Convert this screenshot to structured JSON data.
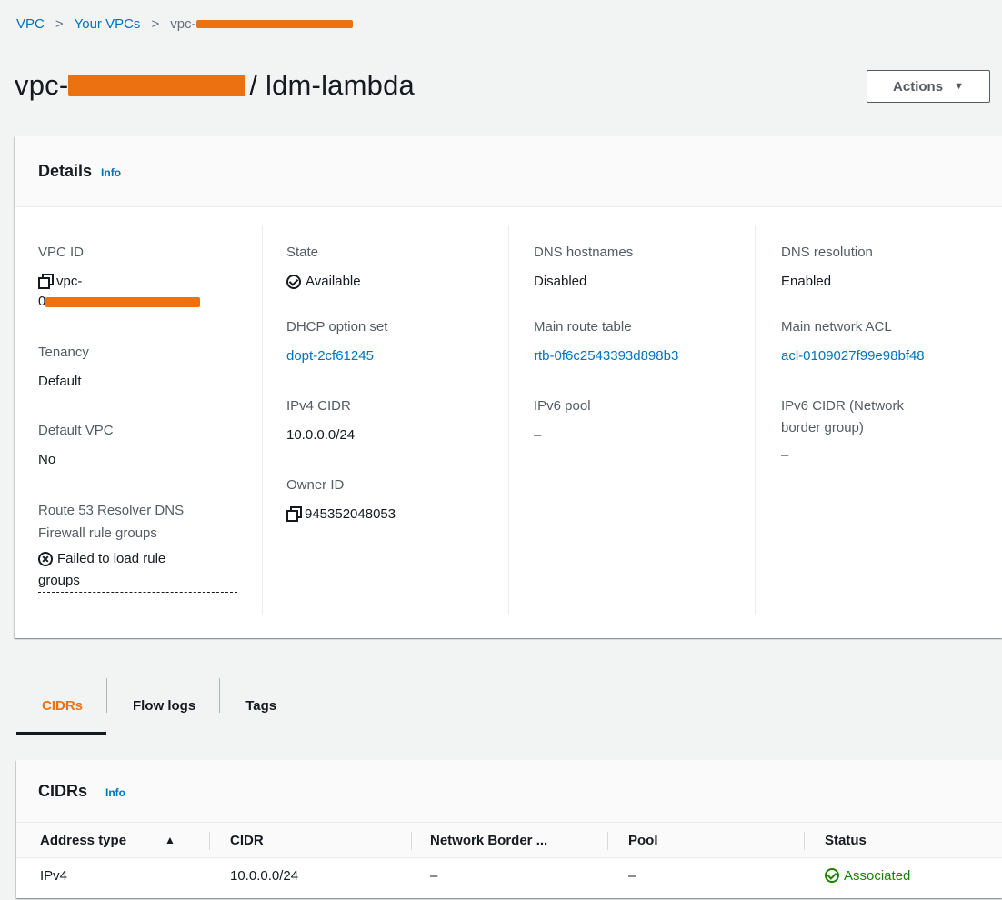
{
  "breadcrumb": {
    "items": [
      "VPC",
      "Your VPCs"
    ],
    "current_prefix": "vpc-",
    "separator": ">"
  },
  "header": {
    "title_prefix": "vpc-",
    "title_suffix": "/ ldm-lambda",
    "actions_label": "Actions"
  },
  "details": {
    "title": "Details",
    "info_label": "Info",
    "col1": {
      "vpc_id_label": "VPC ID",
      "vpc_id_prefix": "vpc-",
      "vpc_id_line2_prefix": "0",
      "tenancy_label": "Tenancy",
      "tenancy_value": "Default",
      "default_vpc_label": "Default VPC",
      "default_vpc_value": "No",
      "route53_label_line1": "Route 53 Resolver DNS",
      "route53_label_line2": "Firewall rule groups",
      "route53_error_line1": "Failed to load rule",
      "route53_error_line2": "groups"
    },
    "col2": {
      "state_label": "State",
      "state_value": "Available",
      "dhcp_label": "DHCP option set",
      "dhcp_value": "dopt-2cf61245",
      "ipv4_label": "IPv4 CIDR",
      "ipv4_value": "10.0.0.0/24",
      "owner_label": "Owner ID",
      "owner_value": "945352048053"
    },
    "col3": {
      "dns_hostnames_label": "DNS hostnames",
      "dns_hostnames_value": "Disabled",
      "route_table_label": "Main route table",
      "route_table_value": "rtb-0f6c2543393d898b3",
      "ipv6_pool_label": "IPv6 pool",
      "ipv6_pool_value": "–"
    },
    "col4": {
      "dns_resolution_label": "DNS resolution",
      "dns_resolution_value": "Enabled",
      "acl_label": "Main network ACL",
      "acl_value": "acl-0109027f99e98bf48",
      "ipv6_cidr_label_line1": "IPv6 CIDR (Network",
      "ipv6_cidr_label_line2": "border group)",
      "ipv6_cidr_value": "–"
    }
  },
  "tabs": [
    {
      "label": "CIDRs",
      "active": true
    },
    {
      "label": "Flow logs",
      "active": false
    },
    {
      "label": "Tags",
      "active": false
    }
  ],
  "cidrs_table": {
    "title": "CIDRs",
    "info_label": "Info",
    "columns": [
      "Address type",
      "CIDR",
      "Network Border ...",
      "Pool",
      "Status"
    ],
    "sort_indicator": "▲",
    "rows": [
      {
        "address_type": "IPv4",
        "cidr": "10.0.0.0/24",
        "network_border": "–",
        "pool": "–",
        "status": "Associated"
      }
    ]
  },
  "colors": {
    "link": "#0073bb",
    "success": "#1d8102",
    "error": "#d13212",
    "accent": "#ec7211",
    "background": "#f2f3f3"
  }
}
